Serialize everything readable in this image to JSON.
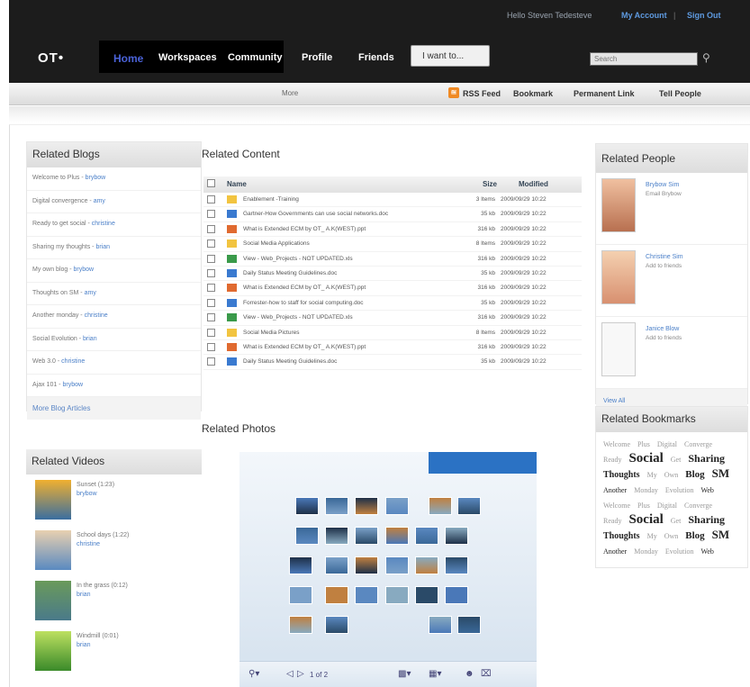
{
  "header": {
    "welcome": "Hello Steven Tedesteve",
    "my_account": "My Account",
    "separator": "|",
    "sign_out": "Sign Out",
    "logo": "OT•",
    "search_placeholder": "Search",
    "nav": [
      "Home",
      "Workspaces",
      "Community",
      "Profile",
      "Friends"
    ],
    "iwant": "I want to..."
  },
  "subbar": {
    "more": "More",
    "links": [
      "RSS Feed",
      "Bookmark",
      "Permanent Link",
      "Tell People"
    ]
  },
  "blogs": {
    "title": "Related Blogs",
    "items": [
      {
        "t": "Welcome to Plus - ",
        "a": "brybow"
      },
      {
        "t": "Digital convergence - ",
        "a": "amy"
      },
      {
        "t": "Ready to get social - ",
        "a": "christine"
      },
      {
        "t": "Sharing my thoughts - ",
        "a": "brian"
      },
      {
        "t": "My own blog - ",
        "a": "brybow"
      },
      {
        "t": "Thoughts on SM - ",
        "a": "amy"
      },
      {
        "t": "Another monday - ",
        "a": "christine"
      },
      {
        "t": "Social Evolution - ",
        "a": "brian"
      },
      {
        "t": "Web 3.0 - ",
        "a": "christine"
      },
      {
        "t": "Ajax 101 - ",
        "a": "brybow"
      }
    ],
    "more": "More Blog Articles"
  },
  "videos": {
    "title": "Related Videos",
    "items": [
      {
        "t": "Sunset (1:23)",
        "a": "brybow"
      },
      {
        "t": "School days (1:22)",
        "a": "christine"
      },
      {
        "t": "In the grass (0:12)",
        "a": "brian"
      },
      {
        "t": "Windmill (0:01)",
        "a": "brian"
      }
    ]
  },
  "content": {
    "title": "Related Content",
    "cols": {
      "name": "Name",
      "size": "Size",
      "mod": "Modified"
    },
    "rows": [
      {
        "n": "Enablement -Training",
        "s": "3 Items",
        "m": "2009/09/29 10:22",
        "k": "folder"
      },
      {
        "n": "Gartner-How Governments can use social networks.doc",
        "s": "35 kb",
        "m": "2009/09/29 10:22",
        "k": "doc"
      },
      {
        "n": "What is Extended ECM by OT_ A.K(WEST).ppt",
        "s": "316 kb",
        "m": "2009/09/29 10:22",
        "k": "ppt"
      },
      {
        "n": "Social Media Applications",
        "s": "8 Items",
        "m": "2009/09/29 10:22",
        "k": "folder"
      },
      {
        "n": "View - Web_Projects - NOT UPDATED.xls",
        "s": "316 kb",
        "m": "2009/09/29 10:22",
        "k": "xls"
      },
      {
        "n": "Daily Status Meeting Guidelines.doc",
        "s": "35 kb",
        "m": "2009/09/29 10:22",
        "k": "doc"
      },
      {
        "n": "What is Extended ECM by OT_ A.K(WEST).ppt",
        "s": "316 kb",
        "m": "2009/09/29 10:22",
        "k": "ppt"
      },
      {
        "n": "Forrester-how to staff for social computing.doc",
        "s": "35 kb",
        "m": "2009/09/29 10:22",
        "k": "doc"
      },
      {
        "n": "View - Web_Projects - NOT UPDATED.xls",
        "s": "316 kb",
        "m": "2009/09/29 10:22",
        "k": "xls"
      },
      {
        "n": "Social Media Pictures",
        "s": "8 Items",
        "m": "2009/09/29 10:22",
        "k": "folder"
      },
      {
        "n": "What is Extended ECM by OT_ A.K(WEST).ppt",
        "s": "316 kb",
        "m": "2009/09/29 10:22",
        "k": "ppt"
      },
      {
        "n": "Daily Status Meeting Guidelines.doc",
        "s": "35 kb",
        "m": "2009/09/29 10:22",
        "k": "doc"
      }
    ]
  },
  "photos": {
    "title": "Related Photos",
    "pager": "1 of 2"
  },
  "people": {
    "title": "Related People",
    "items": [
      {
        "n": "Brybow Sim",
        "a": "Email Brybow"
      },
      {
        "n": "Christine Sim",
        "a": "Add to friends"
      },
      {
        "n": "Janice Blow",
        "a": "Add to friends"
      }
    ],
    "view_all": "View All"
  },
  "bookmarks": {
    "title": "Related Bookmarks",
    "tags": [
      [
        "Welcome",
        8,
        "#999"
      ],
      [
        "Plus",
        8,
        "#999"
      ],
      [
        "Digital",
        8,
        "#999"
      ],
      [
        "Converge",
        8,
        "#999"
      ],
      [
        "Ready",
        8,
        "#999"
      ],
      [
        "Social",
        15,
        "#222"
      ],
      [
        "Get",
        8,
        "#999"
      ],
      [
        "Sharing",
        12,
        "#222"
      ],
      [
        "Thoughts",
        10,
        "#222"
      ],
      [
        "My",
        8,
        "#999"
      ],
      [
        "Own",
        8,
        "#999"
      ],
      [
        "Blog",
        11,
        "#222"
      ],
      [
        "SM",
        13,
        "#222"
      ],
      [
        "Another",
        8,
        "#222"
      ],
      [
        "Monday",
        8,
        "#999"
      ],
      [
        "Evolution",
        8,
        "#999"
      ],
      [
        "Web",
        8,
        "#222"
      ],
      [
        "Welcome",
        8,
        "#999"
      ],
      [
        "Plus",
        8,
        "#999"
      ],
      [
        "Digital",
        8,
        "#999"
      ],
      [
        "Converge",
        8,
        "#999"
      ],
      [
        "Ready",
        8,
        "#999"
      ],
      [
        "Social",
        15,
        "#222"
      ],
      [
        "Get",
        8,
        "#999"
      ],
      [
        "Sharing",
        12,
        "#222"
      ],
      [
        "Thoughts",
        10,
        "#222"
      ],
      [
        "My",
        8,
        "#999"
      ],
      [
        "Own",
        8,
        "#999"
      ],
      [
        "Blog",
        11,
        "#222"
      ],
      [
        "SM",
        13,
        "#222"
      ],
      [
        "Another",
        8,
        "#222"
      ],
      [
        "Monday",
        8,
        "#999"
      ],
      [
        "Evolution",
        8,
        "#999"
      ],
      [
        "Web",
        8,
        "#222"
      ]
    ]
  }
}
